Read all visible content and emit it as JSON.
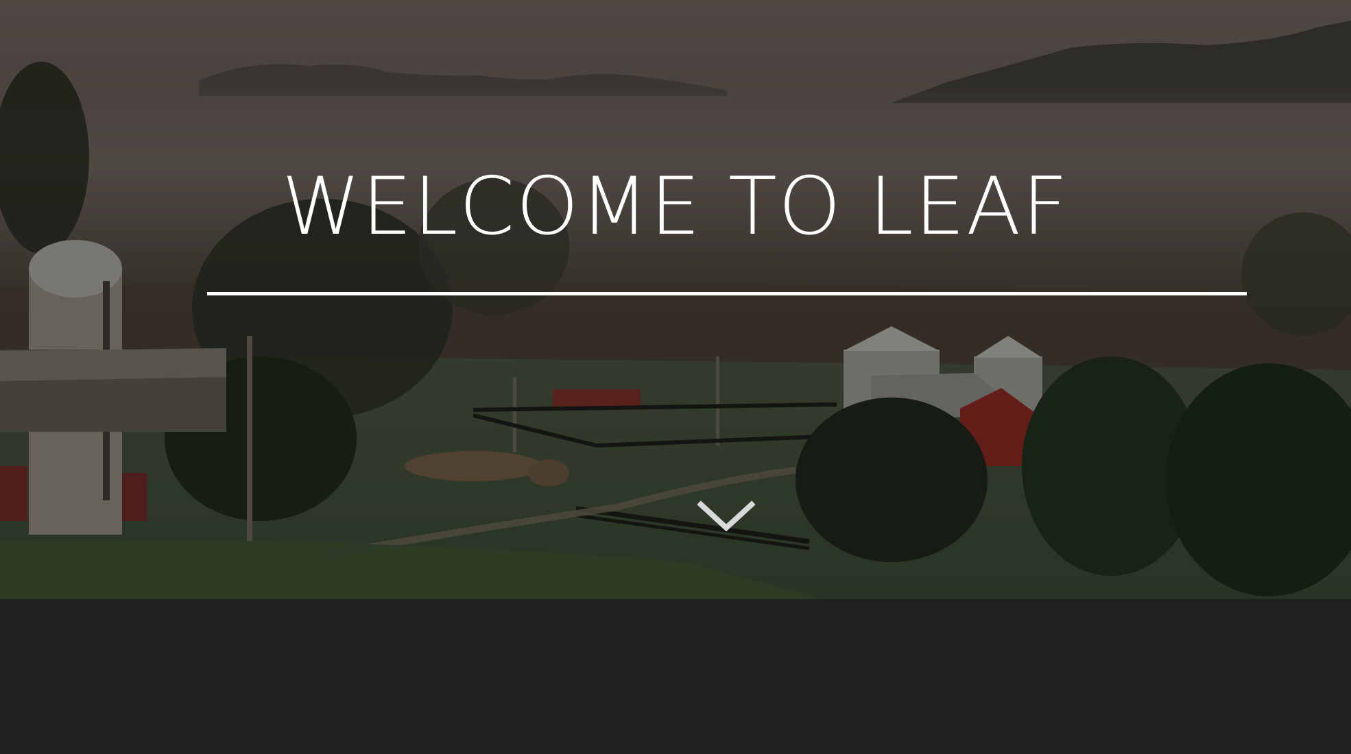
{
  "hero": {
    "title": "WELCOME TO LEAF",
    "background_image": "misty-farm-landscape",
    "scroll_icon": "chevron-down-icon"
  },
  "colors": {
    "title": "#ffffff",
    "divider": "#ffffff",
    "chevron": "#d9d9d9",
    "page_background": "#212121"
  }
}
